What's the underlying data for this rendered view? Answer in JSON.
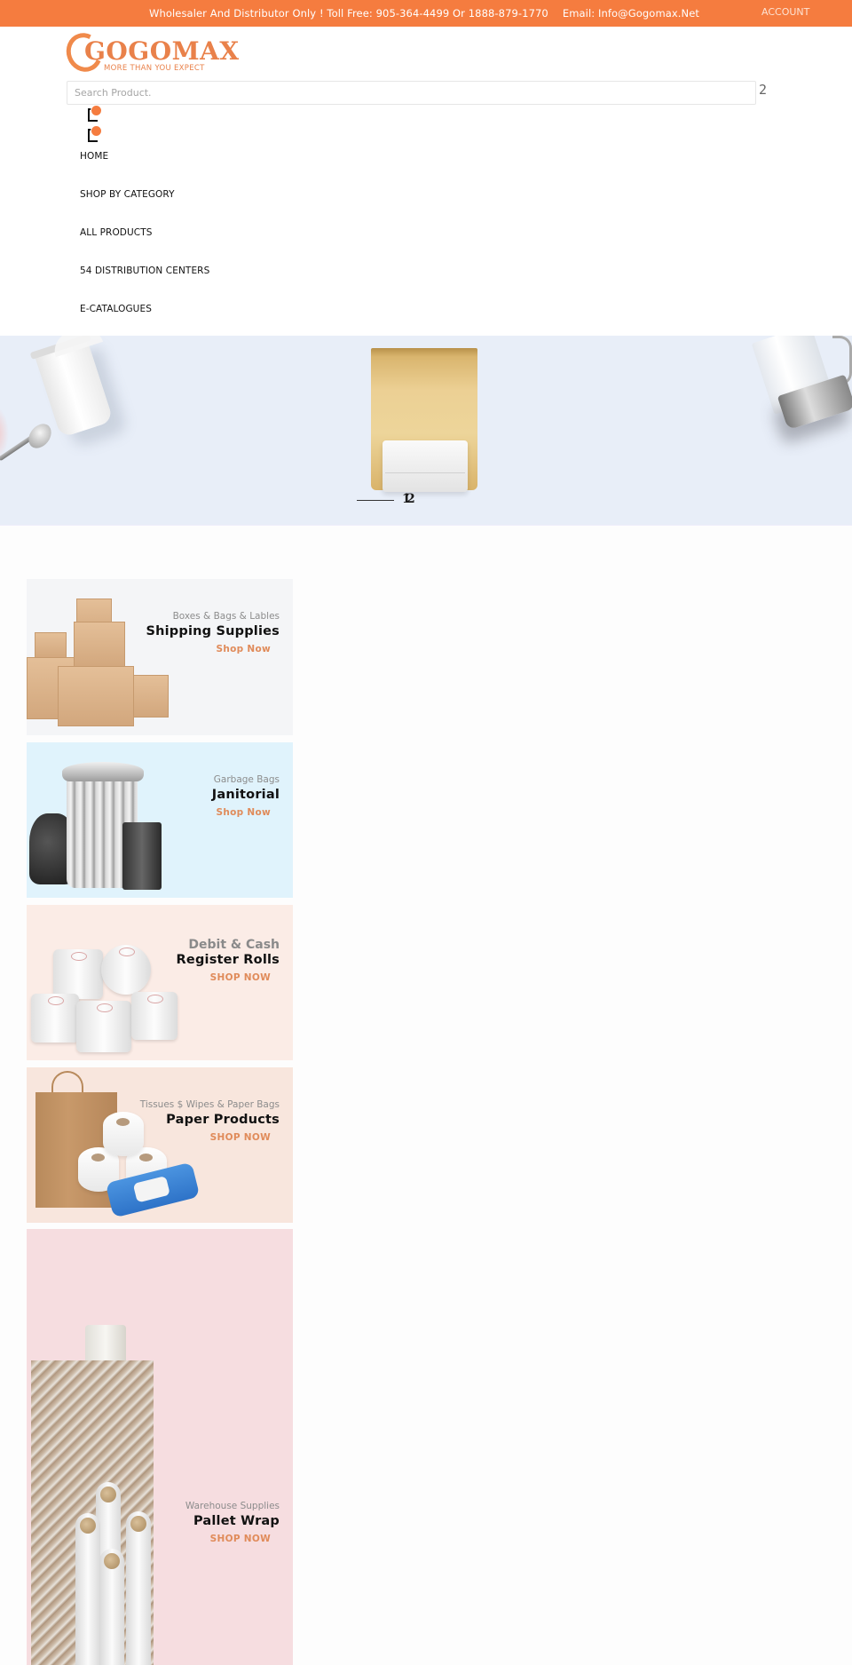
{
  "topbar": {
    "tagline": "Wholesaler And Distributor Only ! Toll Free: 905-364-4499 Or 1888-879-1770",
    "email": "Email: Info@Gogomax.Net",
    "account_label": "ACCOUNT"
  },
  "brand": {
    "name": "GOGOMAX",
    "slogan": "MORE THAN YOU EXPECT",
    "accent": "#f57c3f"
  },
  "search": {
    "placeholder": "Search Product.",
    "value": "",
    "icon_glyph": "2"
  },
  "nav": {
    "items": [
      {
        "label": "HOME"
      },
      {
        "label": "SHOP BY CATEGORY"
      },
      {
        "label": "ALL PRODUCTS"
      },
      {
        "label": "54 DISTRIBUTION CENTERS"
      },
      {
        "label": "E-CATALOGUES"
      }
    ]
  },
  "banner": {
    "slides": [
      "1",
      "2"
    ],
    "active_slide": 1
  },
  "categories": [
    {
      "subtitle": "Boxes & Bags & Lables",
      "title": "Shipping Supplies",
      "cta": "Shop Now"
    },
    {
      "subtitle": "Garbage Bags",
      "title": "Janitorial",
      "cta": "Shop Now"
    },
    {
      "subtitle": "Debit & Cash",
      "title": "Register Rolls",
      "cta": "SHOP NOW"
    },
    {
      "subtitle": "Tissues $ Wipes & Paper Bags",
      "title": "Paper Products",
      "cta": "SHOP NOW"
    },
    {
      "subtitle": "Warehouse Supplies",
      "title": "Pallet Wrap",
      "cta": "SHOP NOW"
    }
  ]
}
